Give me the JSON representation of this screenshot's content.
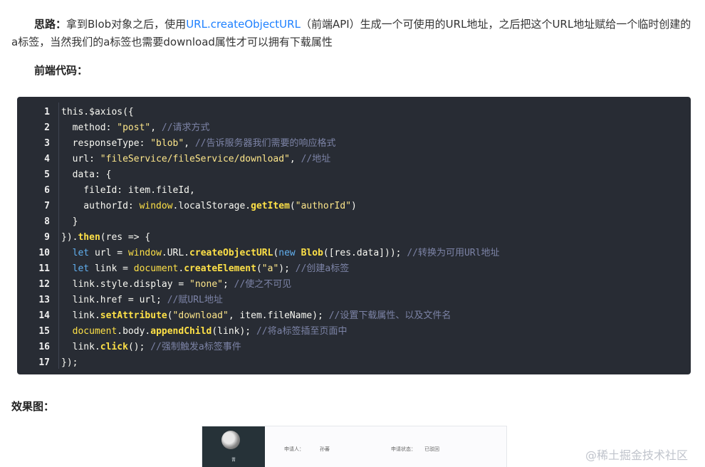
{
  "intro": {
    "label": "思路：",
    "text_before": "拿到Blob对象之后，使用",
    "link": "URL.createObjectURL",
    "text_after": "（前端API）生成一个可使用的URL地址，之后把这个URL地址赋给一个临时创建的a标签，当然我们的a标签也需要download属性才可以拥有下载属性"
  },
  "code_heading": "前端代码：",
  "code_lines": [
    {
      "n": "1",
      "parts": [
        [
          "ident",
          "this.$axios({"
        ]
      ]
    },
    {
      "n": "2",
      "parts": [
        [
          "ident",
          "  method: "
        ],
        [
          "str",
          "\"post\""
        ],
        [
          "ident",
          ", "
        ],
        [
          "cmt",
          "//请求方式"
        ]
      ]
    },
    {
      "n": "3",
      "parts": [
        [
          "ident",
          "  responseType: "
        ],
        [
          "str",
          "\"blob\""
        ],
        [
          "ident",
          ", "
        ],
        [
          "cmt",
          "//告诉服务器我们需要的响应格式"
        ]
      ]
    },
    {
      "n": "4",
      "parts": [
        [
          "ident",
          "  url: "
        ],
        [
          "str",
          "\"fileService/fileService/download\""
        ],
        [
          "ident",
          ", "
        ],
        [
          "cmt",
          "//地址"
        ]
      ]
    },
    {
      "n": "5",
      "parts": [
        [
          "ident",
          "  data: {"
        ]
      ]
    },
    {
      "n": "6",
      "parts": [
        [
          "ident",
          "    fileId: item.fileId,"
        ]
      ]
    },
    {
      "n": "7",
      "parts": [
        [
          "ident",
          "    authorId: "
        ],
        [
          "prop",
          "window"
        ],
        [
          "ident",
          ".localStorage."
        ],
        [
          "fn",
          "getItem"
        ],
        [
          "ident",
          "("
        ],
        [
          "str",
          "\"authorId\""
        ],
        [
          "ident",
          ")"
        ]
      ]
    },
    {
      "n": "8",
      "parts": [
        [
          "ident",
          "  }"
        ]
      ]
    },
    {
      "n": "9",
      "parts": [
        [
          "ident",
          "})."
        ],
        [
          "fn",
          "then"
        ],
        [
          "ident",
          "(res => {"
        ]
      ]
    },
    {
      "n": "10",
      "parts": [
        [
          "ident",
          "  "
        ],
        [
          "kw",
          "let"
        ],
        [
          "ident",
          " url = "
        ],
        [
          "prop",
          "window"
        ],
        [
          "ident",
          ".URL."
        ],
        [
          "fn",
          "createObjectURL"
        ],
        [
          "ident",
          "("
        ],
        [
          "kw",
          "new"
        ],
        [
          "ident",
          " "
        ],
        [
          "fn",
          "Blob"
        ],
        [
          "ident",
          "([res.data])); "
        ],
        [
          "cmt",
          "//转换为可用URl地址"
        ]
      ]
    },
    {
      "n": "11",
      "parts": [
        [
          "ident",
          "  "
        ],
        [
          "kw",
          "let"
        ],
        [
          "ident",
          " link = "
        ],
        [
          "prop",
          "document"
        ],
        [
          "ident",
          "."
        ],
        [
          "fn",
          "createElement"
        ],
        [
          "ident",
          "("
        ],
        [
          "str",
          "\"a\""
        ],
        [
          "ident",
          "); "
        ],
        [
          "cmt",
          "//创建a标签"
        ]
      ]
    },
    {
      "n": "12",
      "parts": [
        [
          "ident",
          "  link.style.display = "
        ],
        [
          "str",
          "\"none\""
        ],
        [
          "ident",
          "; "
        ],
        [
          "cmt",
          "//使之不可见"
        ]
      ]
    },
    {
      "n": "13",
      "parts": [
        [
          "ident",
          "  link.href = url; "
        ],
        [
          "cmt",
          "//赋URL地址"
        ]
      ]
    },
    {
      "n": "14",
      "parts": [
        [
          "ident",
          "  link."
        ],
        [
          "fn",
          "setAttribute"
        ],
        [
          "ident",
          "("
        ],
        [
          "str",
          "\"download\""
        ],
        [
          "ident",
          ", item.fileName); "
        ],
        [
          "cmt",
          "//设置下载属性、以及文件名"
        ]
      ]
    },
    {
      "n": "15",
      "parts": [
        [
          "ident",
          "  "
        ],
        [
          "prop",
          "document"
        ],
        [
          "ident",
          ".body."
        ],
        [
          "fn",
          "appendChild"
        ],
        [
          "ident",
          "(link); "
        ],
        [
          "cmt",
          "//将a标签插至页面中"
        ]
      ]
    },
    {
      "n": "16",
      "parts": [
        [
          "ident",
          "  link."
        ],
        [
          "fn",
          "click"
        ],
        [
          "ident",
          "(); "
        ],
        [
          "cmt",
          "//强制触发a标签事件"
        ]
      ]
    },
    {
      "n": "17",
      "parts": [
        [
          "ident",
          "});"
        ]
      ]
    }
  ],
  "effect_heading": "效果图：",
  "screenshot": {
    "sidebar_name": "晋",
    "applicant_label": "申请人：",
    "applicant_value": "孙蕃",
    "status_label": "申请状态：",
    "status_value": "已驳回"
  },
  "watermark": "@稀土掘金技术社区"
}
